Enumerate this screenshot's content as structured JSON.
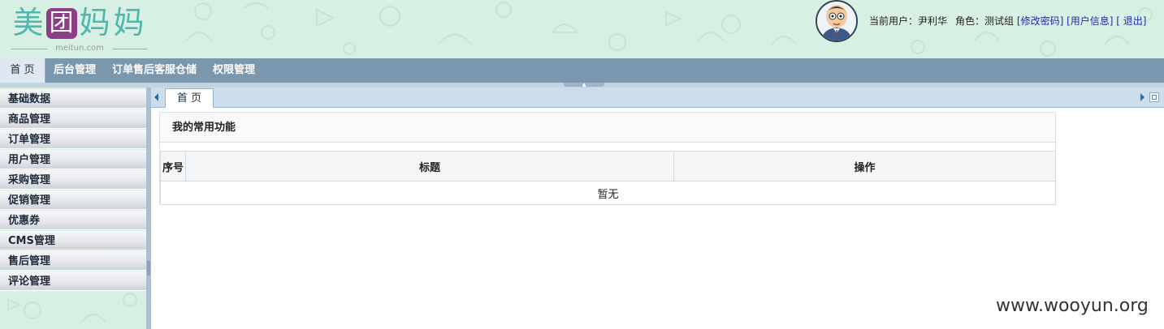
{
  "header": {
    "logo": {
      "chars": [
        "美",
        "团",
        "妈",
        "妈"
      ],
      "subtitle": "meitun.com"
    },
    "user": {
      "current_user_label": "当前用户：",
      "current_user_name": "尹利华",
      "role_label": "角色：",
      "role_name": "测试组",
      "change_password": "[修改密码]",
      "user_info": "[用户信息]",
      "logout": "[ 退出]"
    }
  },
  "topnav": {
    "items": [
      "首 页",
      "后台管理",
      "订单售后客服仓储",
      "权限管理"
    ],
    "active": "首 页"
  },
  "sidebar": {
    "items": [
      "基础数据",
      "商品管理",
      "订单管理",
      "用户管理",
      "采购管理",
      "促销管理",
      "优惠券",
      "CMS管理",
      "售后管理",
      "评论管理"
    ]
  },
  "tabs": {
    "items": [
      "首 页"
    ]
  },
  "panel": {
    "title": "我的常用功能",
    "columns": [
      "序号",
      "标题",
      "操作"
    ],
    "empty_text": "暂无"
  },
  "watermark": "www.wooyun.org",
  "colors": {
    "header_bg": "#d8efe3",
    "nav_bg": "#7b97ad",
    "logo_teal": "#4fb8ae",
    "logo_purple": "#8c3e86",
    "link_blue": "#1b2ca8"
  }
}
